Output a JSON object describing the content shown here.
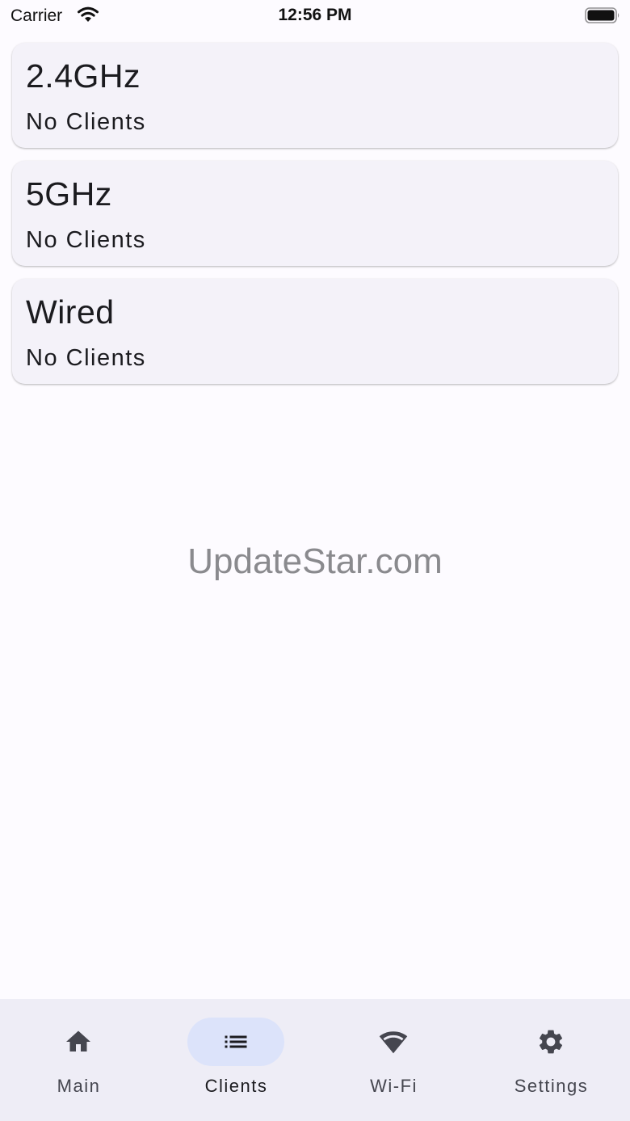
{
  "status_bar": {
    "carrier": "Carrier",
    "time": "12:56 PM",
    "icons": [
      "wifi-icon",
      "battery-icon"
    ]
  },
  "cards": [
    {
      "title": "2.4GHz",
      "status": "No Clients"
    },
    {
      "title": "5GHz",
      "status": "No Clients"
    },
    {
      "title": "Wired",
      "status": "No Clients"
    }
  ],
  "watermark": "UpdateStar.com",
  "bottom_nav": {
    "active": "Clients",
    "items": [
      {
        "label": "Main",
        "icon": "home-icon"
      },
      {
        "label": "Clients",
        "icon": "list-icon"
      },
      {
        "label": "Wi-Fi",
        "icon": "wifi-icon"
      },
      {
        "label": "Settings",
        "icon": "gear-icon"
      }
    ]
  },
  "colors": {
    "background": "#fdfbff",
    "card": "#f4f2f9",
    "nav_background": "#eeedf6",
    "active_pill": "#dce3fa",
    "icon": "#45464f"
  }
}
